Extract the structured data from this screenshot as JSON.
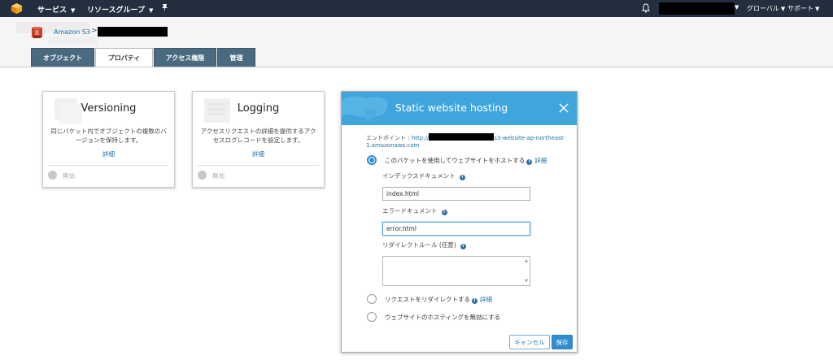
{
  "topnav": {
    "services": "サービス",
    "resource_groups": "リソースグループ",
    "region": "グローバル",
    "support": "サポート"
  },
  "breadcrumb": {
    "root": "Amazon S3",
    "separator": ">"
  },
  "tabs": [
    {
      "label": "オブジェクト",
      "active": false
    },
    {
      "label": "プロパティ",
      "active": true
    },
    {
      "label": "アクセス権限",
      "active": false
    },
    {
      "label": "管理",
      "active": false
    }
  ],
  "cards": [
    {
      "title": "Versioning",
      "description": "同じバケット内でオブジェクトの複数のバージョンを保持します。",
      "link": "詳細",
      "status": "無効"
    },
    {
      "title": "Logging",
      "description": "アクセスリクエストの詳細を提供するアクセスログレコードを設定します。",
      "link": "詳細",
      "status": "無効"
    }
  ],
  "dialog": {
    "title": "Static website hosting",
    "endpoint_label": "エンドポイント : ",
    "endpoint_prefix": "http://",
    "endpoint_suffix": "s3-website-ap-northeast-1.amazonaws.com",
    "option_host": "このバケットを使用してウェブサイトをホストする",
    "option_host_link": "詳細",
    "index_label": "インデックスドキュメント",
    "index_value": "index.html",
    "error_label": "エラードキュメント",
    "error_value": "error.html",
    "redirect_rules_label": "リダイレクトルール (任意)",
    "option_redirect": "リクエストをリダイレクトする",
    "option_redirect_link": "詳細",
    "option_disable": "ウェブサイトのホスティングを無効にする",
    "cancel": "キャンセル",
    "save": "保存",
    "selected_option": "host"
  },
  "colors": {
    "nav_bg": "#232f3e",
    "tab_bg": "#4a6a80",
    "dialog_header": "#3ea6dc",
    "primary": "#2f8ed0"
  }
}
